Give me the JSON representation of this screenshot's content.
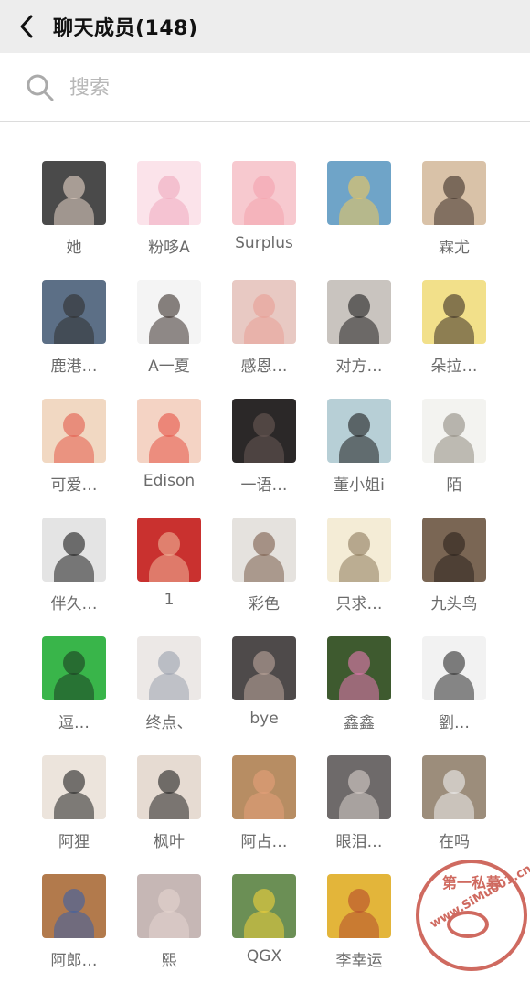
{
  "header": {
    "title": "聊天成员(148)"
  },
  "search": {
    "placeholder": "搜索"
  },
  "members": [
    {
      "name": "她",
      "bg": "#4a4a4a",
      "fg": "#e8d6c8"
    },
    {
      "name": "粉哆A",
      "bg": "#fbe3ea",
      "fg": "#f0a9bd"
    },
    {
      "name": "Surplus",
      "bg": "#f7c9cf",
      "fg": "#f4a2ad"
    },
    {
      "name": "",
      "bg": "#6fa4c8",
      "fg": "#f1c95b"
    },
    {
      "name": "霖尤",
      "bg": "#d9c2a8",
      "fg": "#3a2d26"
    },
    {
      "name": "鹿港…",
      "bg": "#5c6f86",
      "fg": "#2f2f2f"
    },
    {
      "name": "A一夏",
      "bg": "#f4f4f4",
      "fg": "#3b302b"
    },
    {
      "name": "感恩…",
      "bg": "#e8c9c3",
      "fg": "#e89f95"
    },
    {
      "name": "对方…",
      "bg": "#c9c4bf",
      "fg": "#1f1f1f"
    },
    {
      "name": "朵拉…",
      "bg": "#f2e08a",
      "fg": "#3a2d25"
    },
    {
      "name": "可爱…",
      "bg": "#f1d8c2",
      "fg": "#e35b4b"
    },
    {
      "name": "Edison",
      "bg": "#f4d3c4",
      "fg": "#e65446"
    },
    {
      "name": "一语…",
      "bg": "#2b2828",
      "fg": "#6a5a55"
    },
    {
      "name": "董小姐i",
      "bg": "#b7cfd6",
      "fg": "#1c1c1c"
    },
    {
      "name": "陌",
      "bg": "#f3f3f0",
      "fg": "#8f8a80"
    },
    {
      "name": "伴久…",
      "bg": "#e4e4e4",
      "fg": "#1b1b1b"
    },
    {
      "name": "1",
      "bg": "#c9312f",
      "fg": "#f0b69a"
    },
    {
      "name": "彩色",
      "bg": "#e5e2de",
      "fg": "#7a5c4a"
    },
    {
      "name": "只求…",
      "bg": "#f4ecd6",
      "fg": "#8c7a5b"
    },
    {
      "name": "九头鸟",
      "bg": "#7a6654",
      "fg": "#2a201b"
    },
    {
      "name": "逗…",
      "bg": "#39b54a",
      "fg": "#1c3c22"
    },
    {
      "name": "终点、",
      "bg": "#ece8e6",
      "fg": "#9aa0ad"
    },
    {
      "name": "bye",
      "bg": "#4e4a4a",
      "fg": "#bda79c"
    },
    {
      "name": "鑫鑫",
      "bg": "#3e5a2f",
      "fg": "#e879b4"
    },
    {
      "name": "劉…",
      "bg": "#f2f2f2",
      "fg": "#2b2b2b"
    },
    {
      "name": "阿狸",
      "bg": "#ece4dc",
      "fg": "#222222"
    },
    {
      "name": "枫叶",
      "bg": "#e6dbd2",
      "fg": "#202020"
    },
    {
      "name": "阿占…",
      "bg": "#b78d63",
      "fg": "#e6a07a"
    },
    {
      "name": "眼泪…",
      "bg": "#6e6a6a",
      "fg": "#d8d0cb"
    },
    {
      "name": "在吗",
      "bg": "#9c8d7b",
      "fg": "#f0f0f0"
    },
    {
      "name": "阿郎…",
      "bg": "#b27a4c",
      "fg": "#3b5fa6"
    },
    {
      "name": "熙",
      "bg": "#c6b7b5",
      "fg": "#e6d6d0"
    },
    {
      "name": "QGX",
      "bg": "#6b8f55",
      "fg": "#f1d23a"
    },
    {
      "name": "李幸运",
      "bg": "#e3b53a",
      "fg": "#b54a2c"
    }
  ],
  "watermark": {
    "top_text": "第一私募",
    "url_text": "www.SiMu001.cn"
  },
  "colors": {
    "header_bg": "#ededed",
    "text_primary": "#111111",
    "text_secondary": "#6b6b6b",
    "stamp": "#c0392b"
  },
  "icons": {
    "back": "chevron-left-icon",
    "search": "search-icon"
  }
}
